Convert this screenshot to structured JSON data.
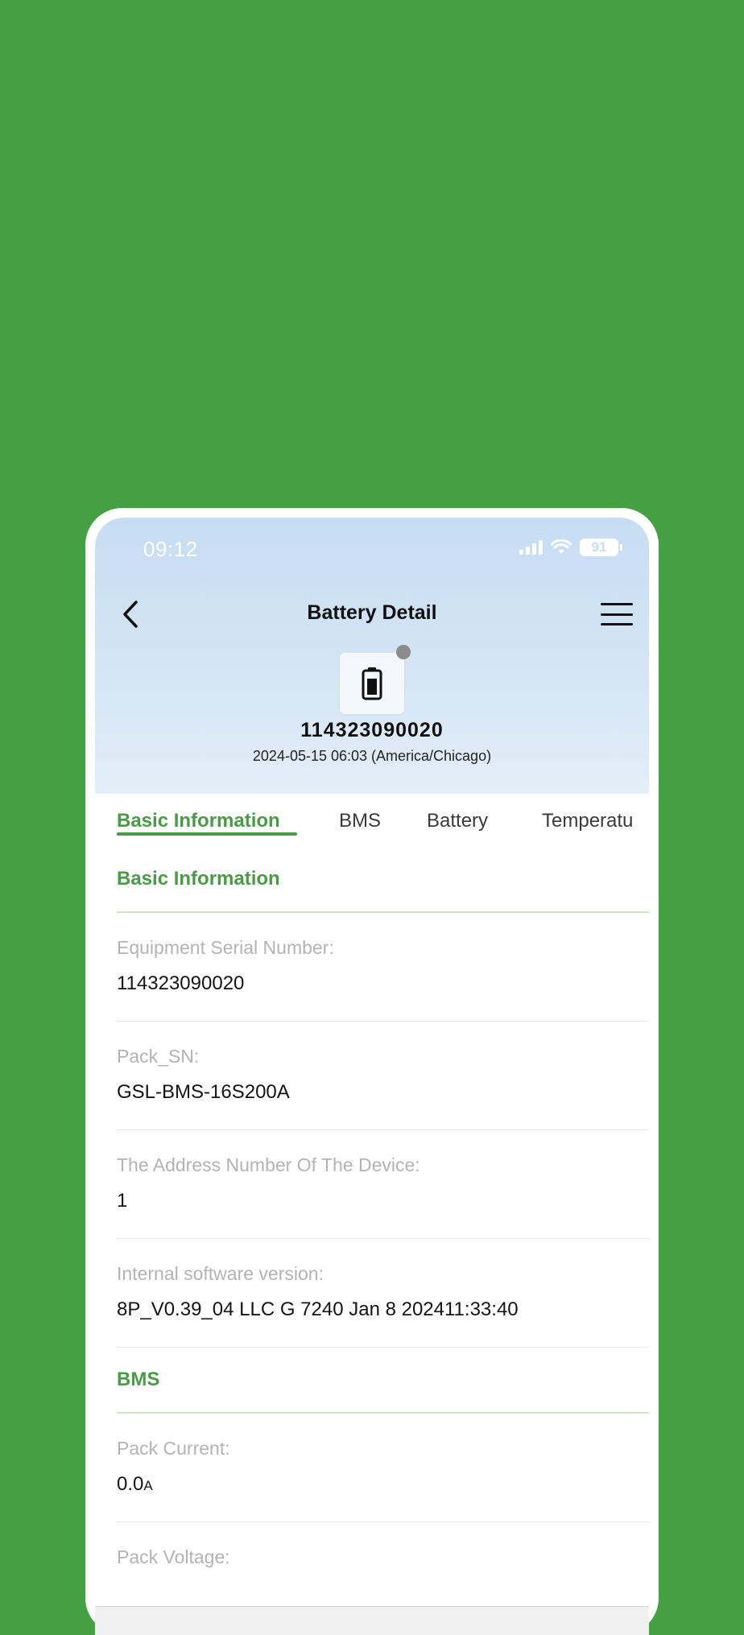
{
  "status_bar": {
    "time": "09:12",
    "battery": "91"
  },
  "header": {
    "title": "Battery Detail"
  },
  "device": {
    "serial": "114323090020",
    "timestamp": "2024-05-15 06:03 (America/Chicago)",
    "status_color": "#8c8c8c"
  },
  "tabs": [
    {
      "label": "Basic Information",
      "active": true
    },
    {
      "label": "BMS",
      "active": false
    },
    {
      "label": "Battery",
      "active": false
    },
    {
      "label": "Temperatu",
      "active": false
    }
  ],
  "sections": {
    "basic": {
      "title": "Basic Information",
      "fields": [
        {
          "label": "Equipment Serial Number:",
          "value": "114323090020"
        },
        {
          "label": "Pack_SN:",
          "value": "GSL-BMS-16S200A"
        },
        {
          "label": "The Address Number Of The Device:",
          "value": "1"
        },
        {
          "label": "Internal software version:",
          "value": "8P_V0.39_04 LLC G 7240 Jan  8 202411:33:40"
        }
      ]
    },
    "bms": {
      "title": "BMS",
      "fields": [
        {
          "label": "Pack Current:",
          "value": "0.0",
          "unit": "A"
        },
        {
          "label": "Pack Voltage:",
          "value": ""
        }
      ]
    }
  },
  "colors": {
    "background": "#45a043",
    "accent": "#4a9a47",
    "hero_top": "#c6ddf3"
  }
}
